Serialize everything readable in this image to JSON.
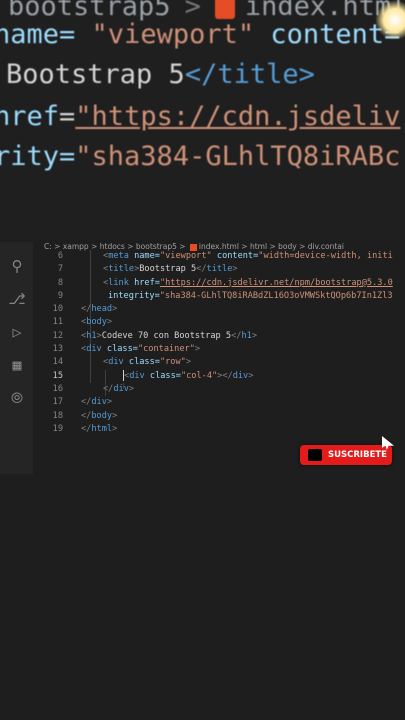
{
  "zoom": {
    "breadcrumb_folder": "bootstrap5",
    "breadcrumb_sep": ">",
    "breadcrumb_file": "index.html",
    "line1_attr": "name=",
    "line1_val": "\"viewport\"",
    "line1_attr2": "content=",
    "line2_text": "Bootstrap 5",
    "line2_close": "</title>",
    "line3_attr": "href",
    "line3_eq": "=",
    "line3_val": "\"https://cdn.jsdeliv",
    "line4_attr": "rity=",
    "line4_val": "\"sha384-GLhlTQ8iRABc"
  },
  "breadcrumb": {
    "drive": "C:",
    "items": [
      "xampp",
      "htdocs",
      "bootstrap5",
      "index.html",
      "html",
      "body",
      "div.contai"
    ]
  },
  "lines": [
    {
      "n": "6",
      "html": "meta"
    },
    {
      "n": "7"
    },
    {
      "n": "8"
    },
    {
      "n": "9"
    },
    {
      "n": "10"
    },
    {
      "n": "11"
    },
    {
      "n": "12"
    },
    {
      "n": "13"
    },
    {
      "n": "14"
    },
    {
      "n": "15"
    },
    {
      "n": "16"
    },
    {
      "n": "17"
    },
    {
      "n": "18"
    },
    {
      "n": "19"
    }
  ],
  "code": {
    "l6": {
      "a1": "name=",
      "v1": "\"viewport\"",
      "a2": "content=",
      "v2": "\"width=device-width, initi"
    },
    "l7": {
      "text": "Bootstrap 5"
    },
    "l8": {
      "attr": "href=",
      "val": "\"https://cdn.jsdelivr.net/npm/bootstrap@5.3.0"
    },
    "l9": {
      "attr": "integrity=",
      "val": "\"sha384-GLhlTQ8iRABdZL16O3oVMWSktQOp6b7In1Zl3"
    },
    "l12": {
      "text": "Codeve 70 con Bootstrap 5"
    },
    "l13": {
      "attr": "class=",
      "val": "\"container\""
    },
    "l14": {
      "attr": "class=",
      "val": "\"row\""
    },
    "l15": {
      "attr": "class=",
      "val": "\"col-4\""
    }
  },
  "subscribe": {
    "label": "SUSCRIBETE"
  },
  "icons": [
    "search-icon",
    "source-control-icon",
    "run-debug-icon",
    "extensions-icon",
    "remote-icon"
  ]
}
